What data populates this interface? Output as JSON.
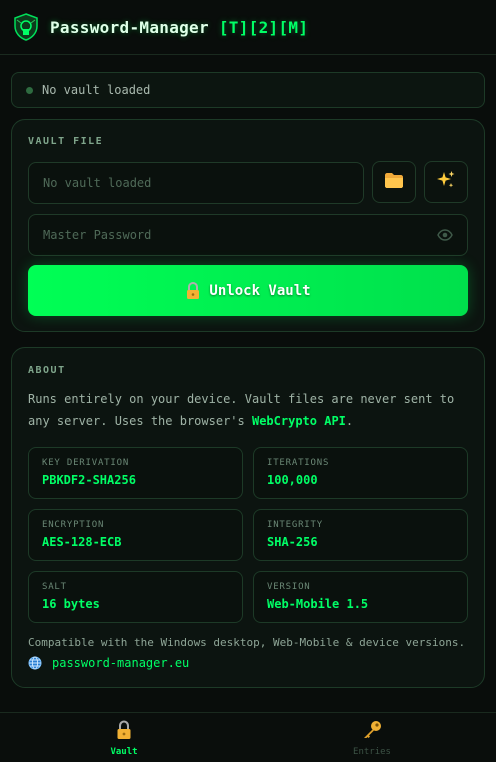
{
  "header": {
    "title_main": "Password-Manager ",
    "title_accent": "[T][2][M]",
    "logo_icon": "shield-logo"
  },
  "status": {
    "text": "No vault loaded",
    "dot_color": "#2e6b40"
  },
  "vault": {
    "section_label": "VAULT FILE",
    "file_placeholder": "No vault loaded",
    "password_placeholder": "Master Password",
    "open_icon": "folder-icon",
    "create_icon": "sparkles-icon",
    "reveal_icon": "eye-icon",
    "unlock_label": "Unlock Vault",
    "unlock_icon": "lock-icon",
    "accent": "#00ff55"
  },
  "about": {
    "section_label": "ABOUT",
    "text_before": "Runs entirely on your device. Vault files are never sent to any server. Uses the browser's ",
    "text_highlight": "WebCrypto API",
    "text_after": ".",
    "info": [
      {
        "label": "KEY DERIVATION",
        "value": "PBKDF2-SHA256"
      },
      {
        "label": "ITERATIONS",
        "value": "100,000"
      },
      {
        "label": "ENCRYPTION",
        "value": "AES-128-ECB"
      },
      {
        "label": "INTEGRITY",
        "value": "SHA-256"
      },
      {
        "label": "SALT",
        "value": "16 bytes"
      },
      {
        "label": "VERSION",
        "value": "Web-Mobile 1.5"
      }
    ],
    "compat_text": "Compatible with the Windows desktop, Web-Mobile & device versions.",
    "site_link": "password-manager.eu",
    "site_icon": "globe-icon"
  },
  "nav": {
    "vault_label": "Vault",
    "entries_label": "Entries",
    "vault_icon": "lock-icon",
    "entries_icon": "key-icon",
    "active": "Vault"
  }
}
